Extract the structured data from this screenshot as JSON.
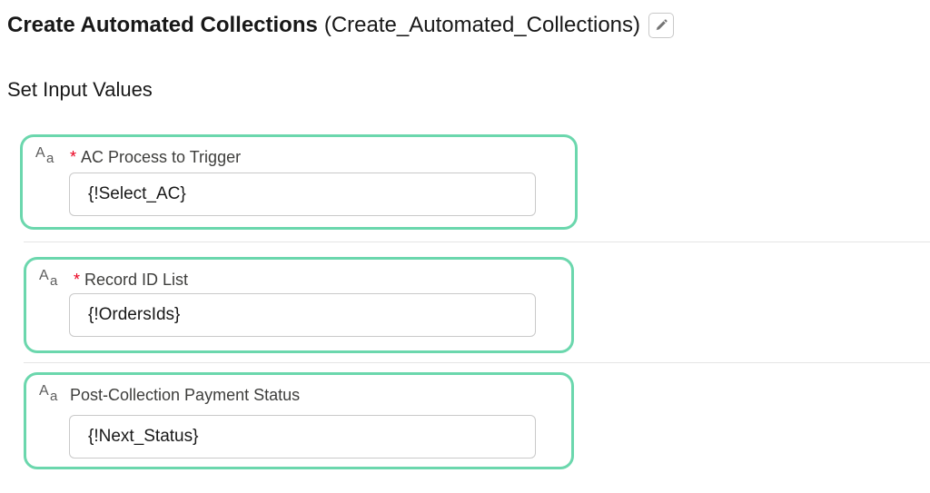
{
  "header": {
    "title": "Create Automated Collections",
    "api_name": "(Create_Automated_Collections)",
    "edit_icon": "pencil-icon"
  },
  "section": {
    "heading": "Set Input Values"
  },
  "fields": [
    {
      "type_icon": "text-type-icon",
      "required": true,
      "required_mark": "*",
      "label": "AC Process to Trigger",
      "value": "{!Select_AC}"
    },
    {
      "type_icon": "text-type-icon",
      "required": true,
      "required_mark": "*",
      "label": "Record ID List",
      "value": "{!OrdersIds}"
    },
    {
      "type_icon": "text-type-icon",
      "required": false,
      "label": "Post-Collection Payment Status",
      "value": "{!Next_Status}"
    }
  ],
  "colors": {
    "highlight_border": "#6bd7ad",
    "required_marker": "#ea001e",
    "input_border": "#c9c9c9",
    "divider": "#e5e5e5"
  }
}
